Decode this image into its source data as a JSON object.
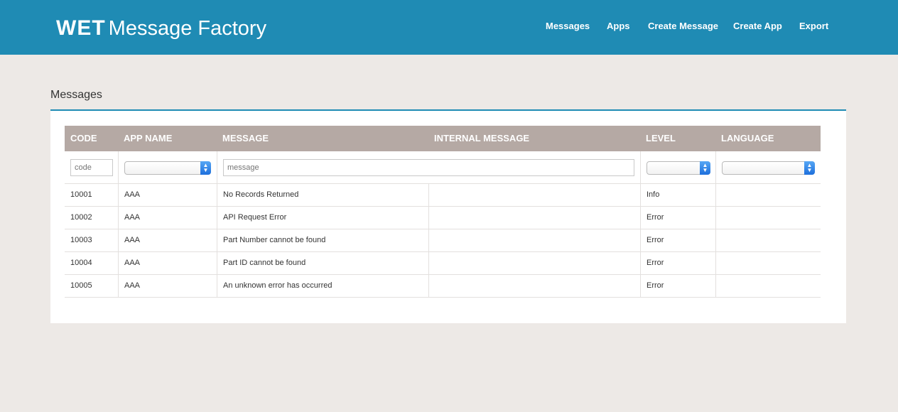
{
  "brand": {
    "bold": "WET",
    "rest": "Message Factory"
  },
  "nav": {
    "items": [
      "Messages",
      "Apps",
      "Create Message",
      "Create App",
      "Export"
    ]
  },
  "page": {
    "section_title": "Messages"
  },
  "table": {
    "headers": [
      "CODE",
      "APP NAME",
      "MESSAGE",
      "INTERNAL MESSAGE",
      "LEVEL",
      "LANGUAGE"
    ],
    "filters": {
      "code_placeholder": "code",
      "message_placeholder": "message"
    },
    "rows": [
      {
        "code": "10001",
        "app_name": "AAA",
        "message": "No Records Returned",
        "internal_message": "",
        "level": "Info",
        "language": ""
      },
      {
        "code": "10002",
        "app_name": "AAA",
        "message": "API Request Error",
        "internal_message": "",
        "level": "Error",
        "language": ""
      },
      {
        "code": "10003",
        "app_name": "AAA",
        "message": "Part Number cannot be found",
        "internal_message": "",
        "level": "Error",
        "language": ""
      },
      {
        "code": "10004",
        "app_name": "AAA",
        "message": "Part ID cannot be found",
        "internal_message": "",
        "level": "Error",
        "language": ""
      },
      {
        "code": "10005",
        "app_name": "AAA",
        "message": "An unknown error has occurred",
        "internal_message": "",
        "level": "Error",
        "language": ""
      }
    ]
  },
  "colors": {
    "header_bg": "#1f8bb4",
    "page_bg": "#ede9e6",
    "table_head_bg": "#b5a9a4"
  }
}
